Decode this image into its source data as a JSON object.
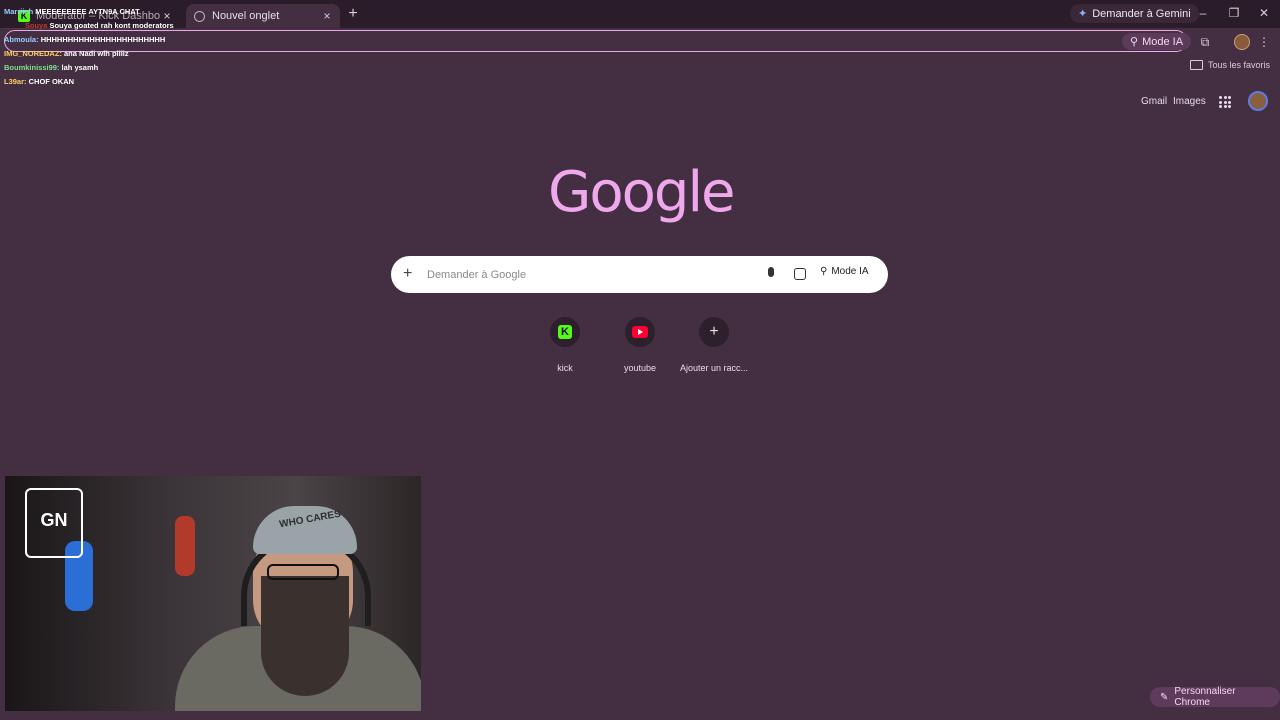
{
  "tabs": {
    "inactive": {
      "title": "Moderator – Kick Dashboard"
    },
    "active": {
      "title": "Nouvel onglet"
    },
    "close_glyph": "×",
    "new_tab_glyph": "+"
  },
  "topbar": {
    "gemini_label": "Demander à Gemini",
    "minimize": "–",
    "restore": "❐",
    "close": "✕"
  },
  "toolbar": {
    "mode_ia": "Mode IA",
    "extensions_icon": "puzzle-icon",
    "menu_glyph": "⋮"
  },
  "bookmarks": {
    "all_favorites": "Tous les favoris"
  },
  "chat": [
    {
      "user": "Marriich",
      "msg": "MEEEEEEEEE AYTN9A CHAT",
      "cls": "u"
    },
    {
      "user": "_____Souya",
      "msg": "Souya goated rah kont moderators",
      "cls": "red"
    },
    {
      "user": "Abmoula:",
      "msg": "HHHHHHHHHHHHHHHHHHHHHHH",
      "cls": "u"
    },
    {
      "user": "IMG_NOREDAZ:",
      "msg": "ana Nadi wlh pliiiz",
      "cls": "u1"
    },
    {
      "user": "Boumkinissi99:",
      "msg": "lah ysamh",
      "cls": "u2"
    },
    {
      "user": "L39ar:",
      "msg": "CHOF OKAN",
      "cls": "u1"
    }
  ],
  "header": {
    "gmail": "Gmail",
    "images": "Images"
  },
  "logo": "Google",
  "search": {
    "placeholder": "Demander à Google",
    "mode_ia": "Mode IA"
  },
  "shortcuts": [
    {
      "label": "kick"
    },
    {
      "label": "youtube"
    },
    {
      "label": "Ajouter un racc..."
    }
  ],
  "webcam": {
    "cap_text": "WHO CARES",
    "logo_text": "GN"
  },
  "customize": {
    "label": "Personnaliser Chrome"
  },
  "colors": {
    "background": "#432e42",
    "accent": "#f0a8ec",
    "kick_green": "#53fc18",
    "youtube_red": "#ff0033"
  }
}
